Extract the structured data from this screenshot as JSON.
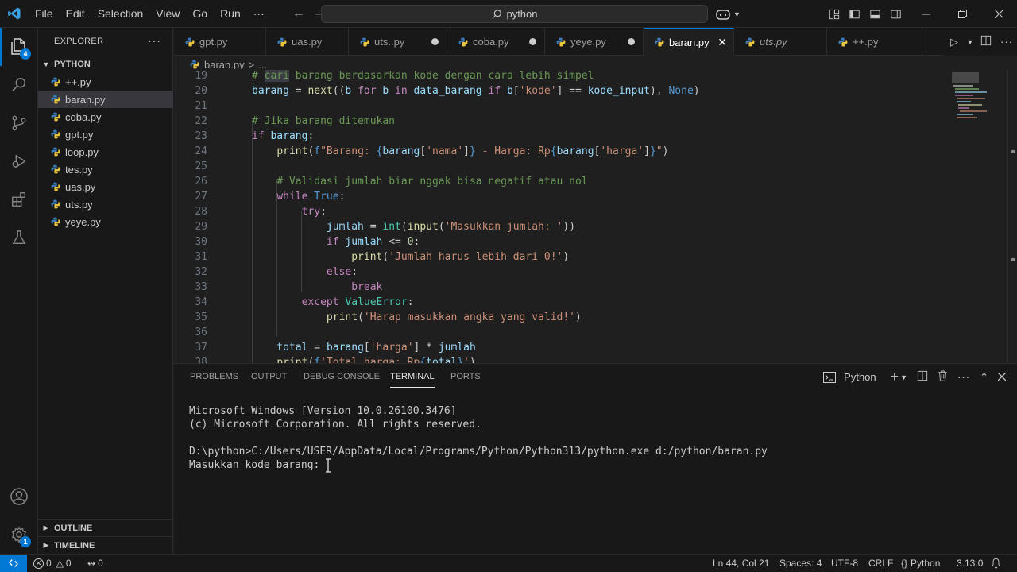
{
  "menu": [
    "File",
    "Edit",
    "Selection",
    "View",
    "Go",
    "Run",
    "···"
  ],
  "search": {
    "text": "python"
  },
  "activity": {
    "explorer_badge": "4",
    "accounts_badge": "1"
  },
  "explorer": {
    "title": "EXPLORER",
    "more": "···",
    "folder": "PYTHON",
    "files": [
      "++.py",
      "baran.py",
      "coba.py",
      "gpt.py",
      "loop.py",
      "tes.py",
      "uas.py",
      "uts.py",
      "yeye.py"
    ],
    "active_file": "baran.py",
    "outline": "OUTLINE",
    "timeline": "TIMELINE"
  },
  "tabs": [
    {
      "label": "gpt.py",
      "state": "normal"
    },
    {
      "label": "uas.py",
      "state": "normal"
    },
    {
      "label": "uts..py",
      "state": "modified"
    },
    {
      "label": "coba.py",
      "state": "modified"
    },
    {
      "label": "yeye.py",
      "state": "modified"
    },
    {
      "label": "baran.py",
      "state": "active"
    },
    {
      "label": "uts.py",
      "state": "preview"
    },
    {
      "label": "++.py",
      "state": "normal"
    }
  ],
  "breadcrumb": {
    "file": "baran.py",
    "sep": ">",
    "rest": "..."
  },
  "editor": {
    "line_numbers": [
      "19",
      "20",
      "21",
      "22",
      "23",
      "24",
      "25",
      "26",
      "27",
      "28",
      "29",
      "30",
      "31",
      "32",
      "33",
      "34",
      "35",
      "36",
      "37",
      "38"
    ]
  },
  "panel": {
    "tabs": [
      "PROBLEMS",
      "OUTPUT",
      "DEBUG CONSOLE",
      "TERMINAL",
      "PORTS"
    ],
    "active_tab": "TERMINAL",
    "shell": "Python",
    "terminal_lines": [
      "Microsoft Windows [Version 10.0.26100.3476]",
      "(c) Microsoft Corporation. All rights reserved.",
      "",
      "D:\\python>C:/Users/USER/AppData/Local/Programs/Python/Python313/python.exe d:/python/baran.py",
      "Masukkan kode barang: "
    ]
  },
  "status": {
    "errors": "0",
    "warnings": "0",
    "ports": "0",
    "position": "Ln 44, Col 21",
    "spaces": "Spaces: 4",
    "encoding": "UTF-8",
    "eol": "CRLF",
    "language": "Python",
    "version": "3.13.0"
  }
}
